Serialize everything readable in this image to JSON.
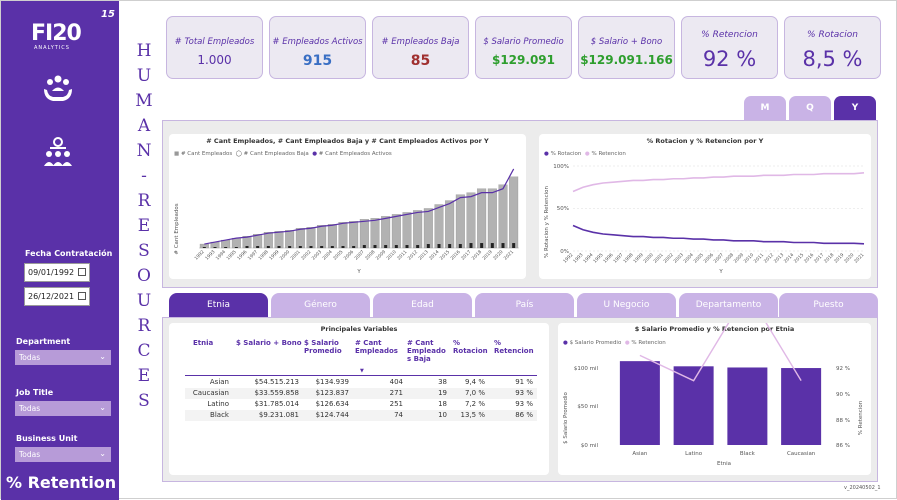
{
  "sidebar": {
    "logo": "FI20",
    "logo_sub": "ANALYTICS",
    "page_number": "15",
    "icons": [
      "people-care-icon",
      "team-icon"
    ],
    "date_label": "Fecha Contratación",
    "date_from": "09/01/1992",
    "date_to": "26/12/2021",
    "filters": [
      {
        "label": "Department",
        "value": "Todas"
      },
      {
        "label": "Job Title",
        "value": "Todas"
      },
      {
        "label": "Business Unit",
        "value": "Todas"
      }
    ],
    "retention_label": "% Retention"
  },
  "vertical_title": [
    "H",
    "U",
    "M",
    "A",
    "N",
    "-",
    "R",
    "E",
    "S",
    "O",
    "U",
    "R",
    "C",
    "E",
    "S"
  ],
  "kpis": [
    {
      "label": "# Total Empleados",
      "value": "1.000",
      "color": "#5a31a8"
    },
    {
      "label": "# Empleados Activos",
      "value": "915",
      "color": "#3a6fc4"
    },
    {
      "label": "# Empleados Baja",
      "value": "85",
      "color": "#a03030"
    },
    {
      "label": "$ Salario Promedio",
      "value": "$129.091",
      "color": "#2e9e2e"
    },
    {
      "label": "$ Salario + Bono",
      "value": "$129.091.166",
      "color": "#2e9e2e"
    },
    {
      "label": "% Retencion",
      "value": "92 %",
      "color": "#5a31a8"
    },
    {
      "label": "% Rotacion",
      "value": "8,5 %",
      "color": "#5a31a8"
    }
  ],
  "period_buttons": [
    {
      "label": "M",
      "active": false
    },
    {
      "label": "Q",
      "active": false
    },
    {
      "label": "Y",
      "active": true
    }
  ],
  "chart_left": {
    "title": "# Cant Empleados, # Cant Empleados Baja y # Cant Empleados Activos por Y",
    "legend": [
      "# Cant Empleados",
      "# Cant Empleados Baja",
      "# Cant Empleados Activos"
    ],
    "ylabel": "# Cant Empleados",
    "xlabel": "Y"
  },
  "chart_right": {
    "title": "% Rotacion y % Retencion por Y",
    "legend": [
      "% Rotacion",
      "% Retencion"
    ],
    "ylabel": "% Rotacion y % Retencion",
    "xlabel": "Y",
    "yticks": [
      "100%",
      "50%",
      "0%"
    ]
  },
  "tabs": [
    {
      "label": "Etnia",
      "active": true
    },
    {
      "label": "Género",
      "active": false
    },
    {
      "label": "Edad",
      "active": false
    },
    {
      "label": "País",
      "active": false
    },
    {
      "label": "U Negocio",
      "active": false
    },
    {
      "label": "Departamento",
      "active": false
    },
    {
      "label": "Puesto",
      "active": false
    }
  ],
  "table": {
    "title": "Principales Variables",
    "headers": [
      "Etnia",
      "$ Salario + Bono",
      "$ Salario Promedio",
      "# Cant Empleados",
      "# Cant Empleado s Baja",
      "% Rotacion",
      "% Retencion"
    ],
    "rows": [
      [
        "Asian",
        "$54.515.213",
        "$134.939",
        "404",
        "38",
        "9,4 %",
        "91 %"
      ],
      [
        "Caucasian",
        "$33.559.858",
        "$123.837",
        "271",
        "19",
        "7,0 %",
        "93 %"
      ],
      [
        "Latino",
        "$31.785.014",
        "$126.634",
        "251",
        "18",
        "7,2 %",
        "93 %"
      ],
      [
        "Black",
        "$9.231.081",
        "$124.744",
        "74",
        "10",
        "13,5 %",
        "86 %"
      ]
    ]
  },
  "chart_data": [
    {
      "type": "bar",
      "title": "# Cant Empleados, # Cant Empleados Baja y # Cant Empleados Activos por Y",
      "xlabel": "Y",
      "ylabel": "# Cant Empleados",
      "categories": [
        "1992",
        "1993",
        "1994",
        "1995",
        "1996",
        "1997",
        "1998",
        "1999",
        "2000",
        "2001",
        "2002",
        "2003",
        "2004",
        "2005",
        "2006",
        "2007",
        "2008",
        "2009",
        "2010",
        "2011",
        "2012",
        "2013",
        "2014",
        "2015",
        "2016",
        "2017",
        "2018",
        "2019",
        "2020",
        "2021"
      ],
      "series": [
        {
          "name": "# Cant Empleados",
          "values": [
            4,
            6,
            8,
            10,
            12,
            14,
            16,
            17,
            18,
            20,
            21,
            23,
            24,
            26,
            27,
            29,
            30,
            32,
            34,
            36,
            38,
            40,
            44,
            48,
            54,
            56,
            60,
            60,
            64,
            72
          ]
        },
        {
          "name": "# Cant Empleados Baja",
          "values": [
            0,
            0,
            0,
            0,
            1,
            1,
            1,
            1,
            1,
            1,
            1,
            1,
            1,
            1,
            1,
            2,
            2,
            2,
            2,
            2,
            2,
            3,
            3,
            3,
            3,
            4,
            4,
            4,
            4,
            4
          ]
        },
        {
          "name": "# Cant Empleados Activos",
          "values": [
            4,
            6,
            8,
            10,
            11,
            13,
            15,
            16,
            17,
            19,
            20,
            22,
            23,
            25,
            26,
            27,
            28,
            30,
            32,
            34,
            36,
            37,
            41,
            45,
            51,
            52,
            56,
            56,
            60,
            80
          ]
        }
      ]
    },
    {
      "type": "line",
      "title": "% Rotacion y % Retencion por Y",
      "xlabel": "Y",
      "ylabel": "% Rotacion y % Retencion",
      "ylim": [
        0,
        100
      ],
      "categories": [
        "1992",
        "1993",
        "1994",
        "1995",
        "1996",
        "1997",
        "1998",
        "1999",
        "2000",
        "2001",
        "2002",
        "2003",
        "2004",
        "2005",
        "2006",
        "2007",
        "2008",
        "2009",
        "2010",
        "2011",
        "2012",
        "2013",
        "2014",
        "2015",
        "2016",
        "2017",
        "2018",
        "2019",
        "2020",
        "2021"
      ],
      "series": [
        {
          "name": "% Rotacion",
          "values": [
            30,
            25,
            22,
            20,
            19,
            18,
            17,
            17,
            16,
            16,
            15,
            15,
            14,
            14,
            13,
            13,
            12,
            12,
            12,
            11,
            11,
            11,
            10,
            10,
            10,
            9,
            9,
            9,
            9,
            8.5
          ]
        },
        {
          "name": "% Retencion",
          "values": [
            70,
            75,
            78,
            80,
            81,
            82,
            83,
            83,
            84,
            84,
            85,
            85,
            86,
            86,
            87,
            87,
            88,
            88,
            88,
            89,
            89,
            89,
            90,
            90,
            90,
            91,
            91,
            91,
            91,
            92
          ]
        }
      ]
    },
    {
      "type": "bar",
      "title": "$ Salario Promedio y % Retencion por Etnia",
      "xlabel": "Etnia",
      "ylabel": "$ Salario Promedio",
      "y2label": "% Retencion",
      "yticks": [
        "$100 mil",
        "$50 mil",
        "$0 mil"
      ],
      "y2ticks": [
        "92 %",
        "90 %",
        "88 %",
        "86 %"
      ],
      "categories": [
        "Asian",
        "Latino",
        "Black",
        "Caucasian"
      ],
      "series": [
        {
          "name": "$ Salario Promedio",
          "values": [
            134939,
            126634,
            124744,
            123837
          ]
        },
        {
          "name": "% Retencion",
          "values": [
            91,
            93,
            86,
            93
          ]
        }
      ]
    }
  ],
  "version": "v_20240502_1",
  "colors": {
    "brand": "#5a31a8",
    "light": "#c9b3e6",
    "retencion": "#e0b8e6"
  }
}
